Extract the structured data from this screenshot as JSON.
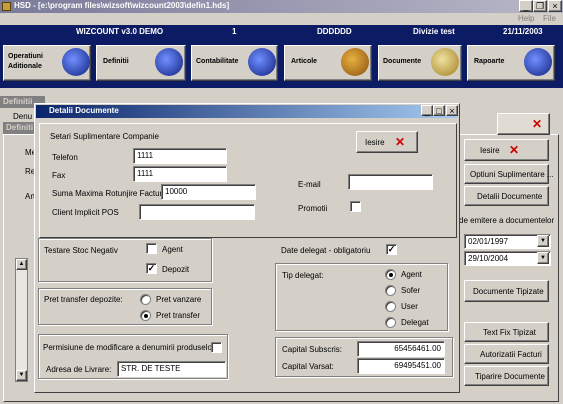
{
  "window": {
    "title": "HSD - [e:\\program files\\wizsoft\\wizcount2003\\defin1.hds]",
    "menu": [
      "Help",
      "File"
    ]
  },
  "statusbar": {
    "app": "WIZCOUNT v3.0 DEMO",
    "num": "1",
    "code": "DDDDDD",
    "company": "Divizie test",
    "date": "21/11/2003"
  },
  "toolbar": [
    {
      "name": "operatiuni",
      "label": "Operatiuni\nAditionale"
    },
    {
      "name": "definitii",
      "label": "Definitii"
    },
    {
      "name": "contabilitate",
      "label": "Contabilitate"
    },
    {
      "name": "articole",
      "label": "Articole"
    },
    {
      "name": "documente",
      "label": "Documente"
    },
    {
      "name": "rapoarte",
      "label": "Rapoarte"
    }
  ],
  "background_window": {
    "title1": "Definitii",
    "title2": "Definiti",
    "labels": [
      "Denu",
      "Me",
      "Re",
      "Art"
    ],
    "iesire": "Iesire",
    "buttons": [
      "Optiuni Suplimentare ...",
      "Detalii Documente"
    ],
    "emitere": "de emitere a documentelor",
    "date1": "02/01/1997",
    "date2": "29/10/2004",
    "documente_tipizate": "Documente Tipizate",
    "bottom_buttons": [
      "Text Fix Tipizat",
      "Autorizatii Facturi",
      "Tiparire Documente"
    ]
  },
  "dialog": {
    "title": "Detalii Documente",
    "section": "Setari Suplimentare Companie",
    "iesire": "Iesire",
    "telefon_label": "Telefon",
    "telefon": "1111",
    "fax_label": "Fax",
    "fax": "1111",
    "rotunjire_label": "Suma Maxima Rotunjire Factura",
    "rotunjire": "10000",
    "client_label": "Client Implicit POS",
    "client": "",
    "email_label": "E-mail",
    "email": "",
    "promotii_label": "Promotii",
    "stoc_label": "Testare Stoc Negativ",
    "agent_label": "Agent",
    "depozit_label": "Depozit",
    "pret_label": "Pret transfer depozite:",
    "pret_vanzare": "Pret vanzare",
    "pret_transfer": "Pret transfer",
    "delegat_oblig": "Date delegat - obligatoriu",
    "tip_delegat": "Tip delegat:",
    "delegat_opts": [
      "Agent",
      "Sofer",
      "User",
      "Delegat"
    ],
    "permisiune_label": "Permisiune de modificare a denumirii produselor:",
    "adresa_label": "Adresa de Livrare:",
    "adresa": "STR. DE TESTE",
    "capital_subscris_label": "Capital Subscris:",
    "capital_subscris": "65456461.00",
    "capital_varsat_label": "Capital Varsat:",
    "capital_varsat": "69495451.00"
  },
  "colors": {
    "title_active": "#0a246a",
    "title_gradient": "#a6caf0",
    "toolbar_bg": "#0c1c64",
    "accent_red": "#d00000"
  }
}
